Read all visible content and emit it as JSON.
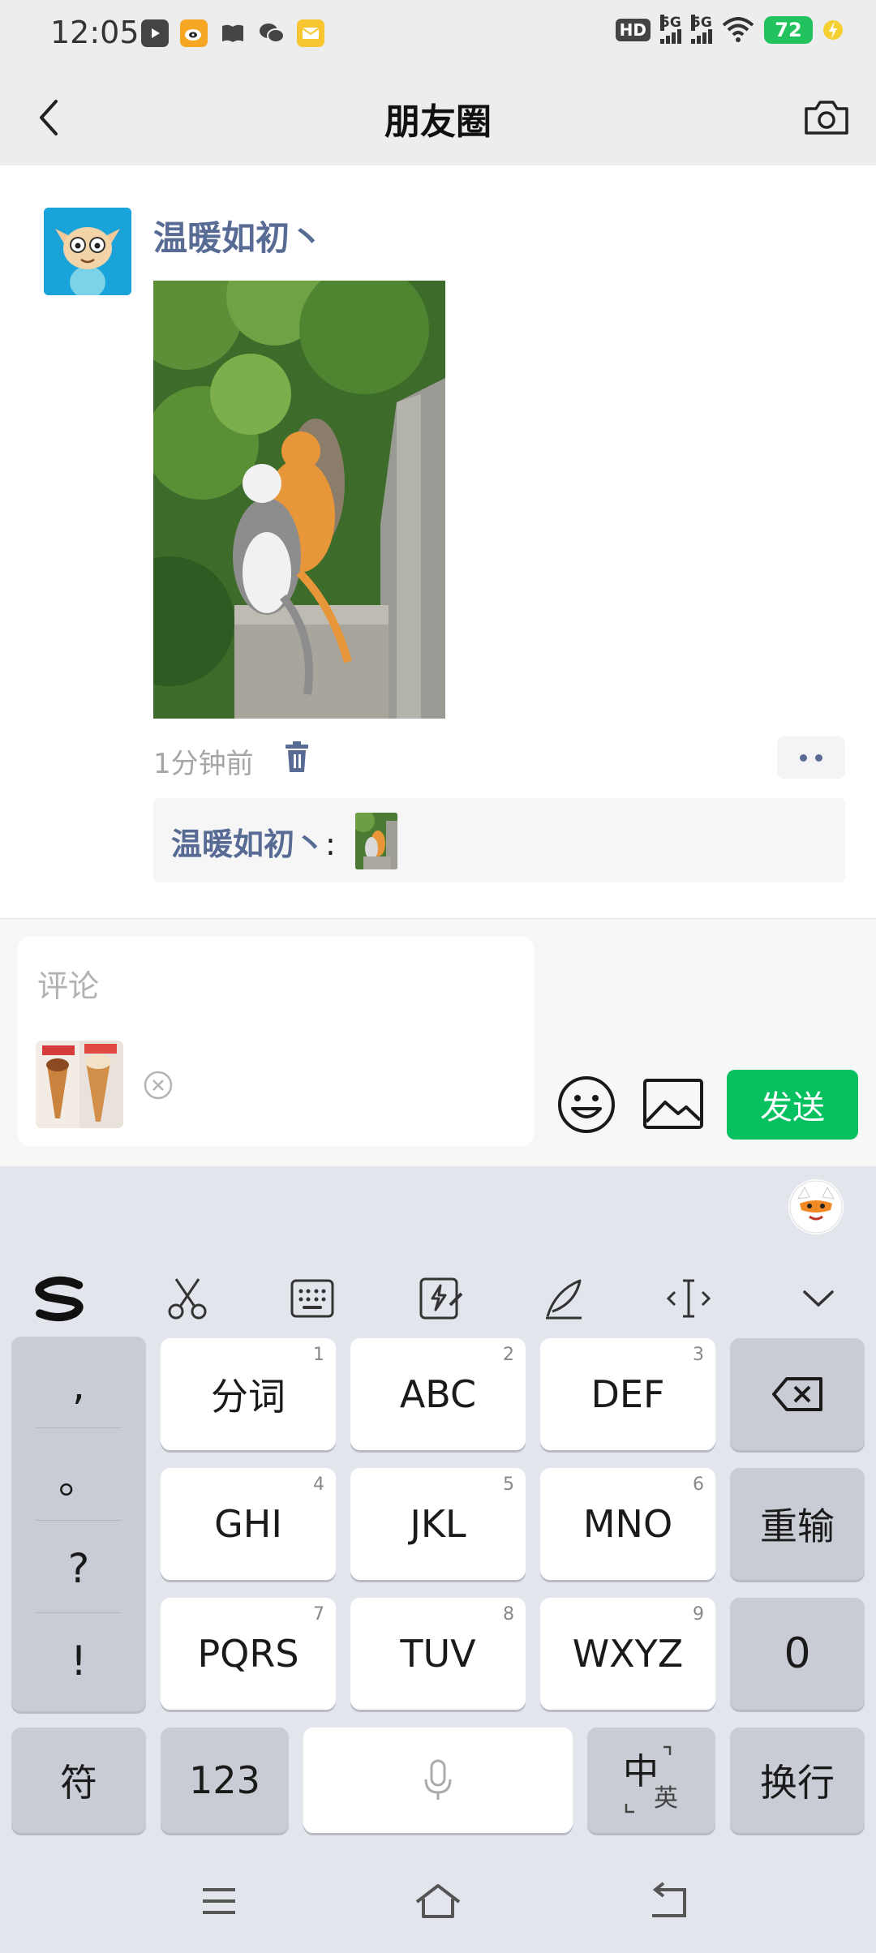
{
  "status_bar": {
    "time": "12:05",
    "hd_label": "HD",
    "sim1_label": "5G",
    "sim2_label": "5G",
    "battery": "72",
    "app_icons": [
      "video-app-icon",
      "weibo-icon",
      "book-icon",
      "wechat-icon",
      "mail-icon"
    ]
  },
  "nav": {
    "title": "朋友圈",
    "back_icon": "chevron-left-icon",
    "camera_icon": "camera-icon"
  },
  "post": {
    "author": "温暖如初丶",
    "time": "1分钟前",
    "comments": [
      {
        "author": "温暖如初丶",
        "separator": ":"
      }
    ]
  },
  "comment_input": {
    "placeholder": "评论",
    "send_label": "发送"
  },
  "keyboard": {
    "toolbar": [
      "sogou-logo-icon",
      "scissors-icon",
      "keyboard-icon",
      "quick-phrase-icon",
      "handwriting-icon",
      "cursor-icon",
      "collapse-icon"
    ],
    "punctuation": [
      ",",
      "。",
      "?",
      "!"
    ],
    "rows": [
      [
        {
          "label": "分词",
          "num": "1"
        },
        {
          "label": "ABC",
          "num": "2"
        },
        {
          "label": "DEF",
          "num": "3"
        }
      ],
      [
        {
          "label": "GHI",
          "num": "4"
        },
        {
          "label": "JKL",
          "num": "5"
        },
        {
          "label": "MNO",
          "num": "6"
        }
      ],
      [
        {
          "label": "PQRS",
          "num": "7"
        },
        {
          "label": "TUV",
          "num": "8"
        },
        {
          "label": "WXYZ",
          "num": "9"
        }
      ]
    ],
    "reinput_label": "重输",
    "zero_label": "0",
    "symbol_label": "符",
    "numeric_label": "123",
    "lang_main": "中",
    "lang_sub": "英",
    "enter_label": "换行"
  },
  "colors": {
    "accent_green": "#07c160",
    "name_blue": "#576b95",
    "battery_green": "#22c35e"
  }
}
